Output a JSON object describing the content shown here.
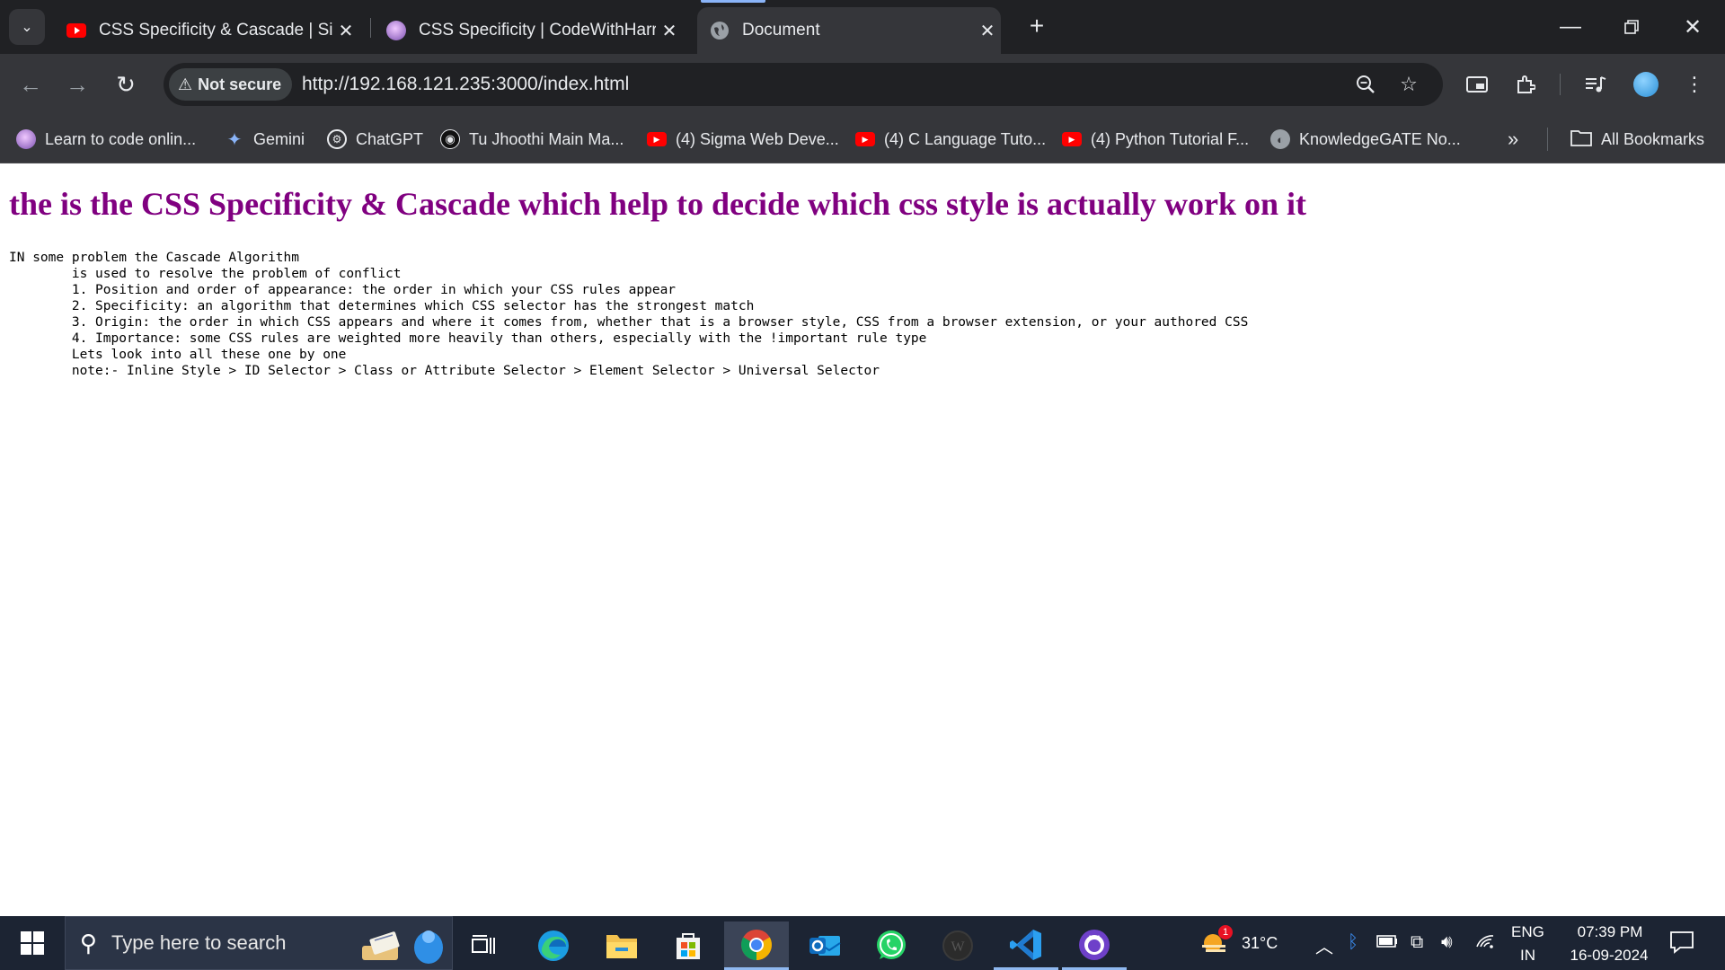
{
  "browser": {
    "tabs": [
      {
        "title": "CSS Specificity & Cascade | Sigma",
        "favicon": "youtube-icon",
        "active": false
      },
      {
        "title": "CSS Specificity | CodeWithHarry",
        "favicon": "codewithharry-icon",
        "active": false
      },
      {
        "title": "Document",
        "favicon": "globe-icon",
        "active": true
      }
    ],
    "security_label": "Not secure",
    "url": "http://192.168.121.235:3000/index.html",
    "bookmarks": [
      {
        "label": "Learn to code onlin...",
        "icon": "codewithharry-icon"
      },
      {
        "label": "Gemini",
        "icon": "gemini-icon"
      },
      {
        "label": "ChatGPT",
        "icon": "chatgpt-icon"
      },
      {
        "label": "Tu Jhoothi Main Ma...",
        "icon": "music-icon"
      },
      {
        "label": "(4) Sigma Web Deve...",
        "icon": "youtube-icon"
      },
      {
        "label": "(4) C Language Tuto...",
        "icon": "youtube-icon"
      },
      {
        "label": "(4) Python Tutorial F...",
        "icon": "youtube-icon"
      },
      {
        "label": "KnowledgeGATE No...",
        "icon": "globe-icon"
      }
    ],
    "all_bookmarks_label": "All Bookmarks"
  },
  "page": {
    "heading": "the is the CSS Specificity & Cascade which help to decide which css style is actually work on it",
    "pre_lines": [
      "IN some problem the Cascade Algorithm",
      "        is used to resolve the problem of conflict",
      "        1. Position and order of appearance: the order in which your CSS rules appear",
      "        2. Specificity: an algorithm that determines which CSS selector has the strongest match",
      "        3. Origin: the order in which CSS appears and where it comes from, whether that is a browser style, CSS from a browser extension, or your authored CSS",
      "        4. Importance: some CSS rules are weighted more heavily than others, especially with the !important rule type",
      "        Lets look into all these one by one",
      "        note:- Inline Style > ID Selector > Class or Attribute Selector > Element Selector > Universal Selector"
    ]
  },
  "taskbar": {
    "search_placeholder": "Type here to search",
    "weather_temp": "31°C",
    "weather_badge": "1",
    "language": "ENG",
    "region": "IN",
    "time": "07:39 PM",
    "date": "16-09-2024"
  },
  "colors": {
    "heading": "#800080",
    "chrome_dark": "#202124",
    "chrome_toolbar": "#35363a",
    "taskbar": "#1c2433"
  }
}
